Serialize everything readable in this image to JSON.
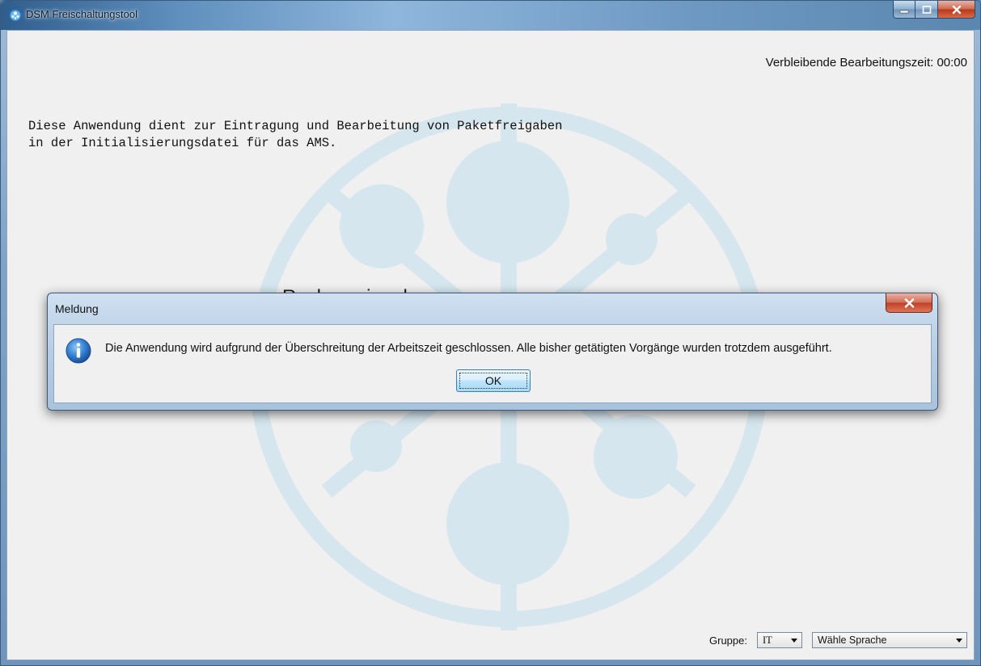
{
  "window": {
    "title": "DSM Freischaltungstool",
    "caption_buttons": {
      "minimize": "_",
      "maximize": "☐",
      "close": "X"
    }
  },
  "main": {
    "remaining_time": "Verbleibende Bearbeitungszeit: 00:00",
    "intro_text": "Diese Anwendung dient zur Eintragung und Bearbeitung von Paketfreigaben\nin der Initialisierungsdatei für das AMS.",
    "heading_partial": "Rechnereingabe"
  },
  "bottom": {
    "group_label": "Gruppe:",
    "group_value": "IT",
    "language_value": "Wähle Sprache"
  },
  "dialog": {
    "title": "Meldung",
    "close_label": "X",
    "icon": "info-icon",
    "message": "Die Anwendung wird aufgrund der Überschreitung der Arbeitszeit geschlossen. Alle bisher getätigten Vorgänge wurden trotzdem ausgeführt.",
    "ok_label": "OK"
  },
  "colors": {
    "watermark": "#d6e6ef",
    "accent": "#3c7fb1",
    "close_red": "#c0402a"
  }
}
